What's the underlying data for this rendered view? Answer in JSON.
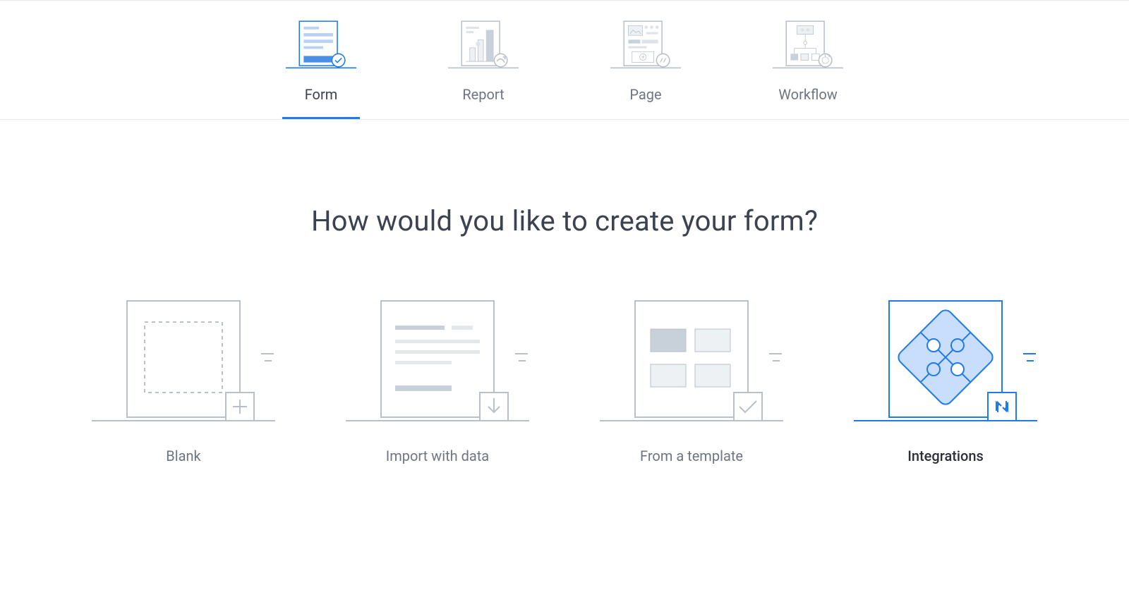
{
  "tabs": [
    {
      "label": "Form",
      "active": true
    },
    {
      "label": "Report",
      "active": false
    },
    {
      "label": "Page",
      "active": false
    },
    {
      "label": "Workflow",
      "active": false
    }
  ],
  "heading": "How would you like to create your form?",
  "options": [
    {
      "label": "Blank"
    },
    {
      "label": "Import with data"
    },
    {
      "label": "From a template"
    },
    {
      "label": "Integrations",
      "highlight": true
    }
  ],
  "colors": {
    "accent": "#1f7aea",
    "accent_light": "#b7d2f5",
    "muted": "#b9c0c9",
    "muted_light": "#e4e8ec",
    "text": "#3c4350",
    "text_muted": "#6d7682"
  }
}
